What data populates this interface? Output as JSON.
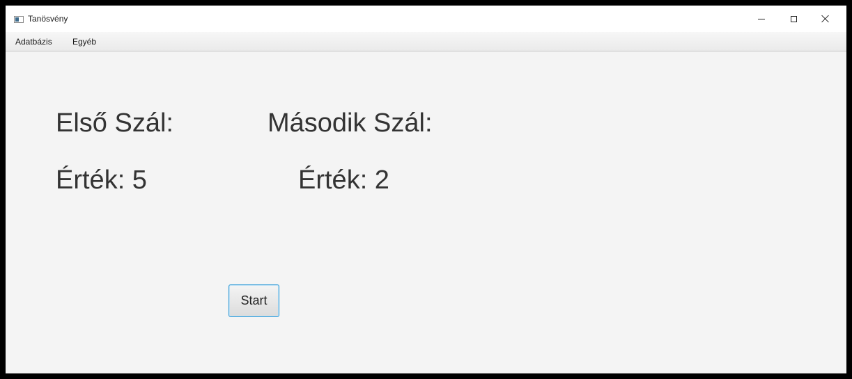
{
  "window": {
    "title": "Tanösvény",
    "controls": {
      "minimize": "minimize-icon",
      "maximize": "maximize-icon",
      "close": "close-icon"
    }
  },
  "menubar": {
    "items": [
      {
        "label": "Adatbázis"
      },
      {
        "label": "Egyéb"
      }
    ]
  },
  "main": {
    "first_thread_label": "Első Szál:",
    "second_thread_label": "Második Szál:",
    "first_value": "Érték: 5",
    "second_value": "Érték: 2",
    "start_button": "Start"
  },
  "colors": {
    "background": "#f4f4f4",
    "button_focus_border": "#2f9ad6"
  }
}
